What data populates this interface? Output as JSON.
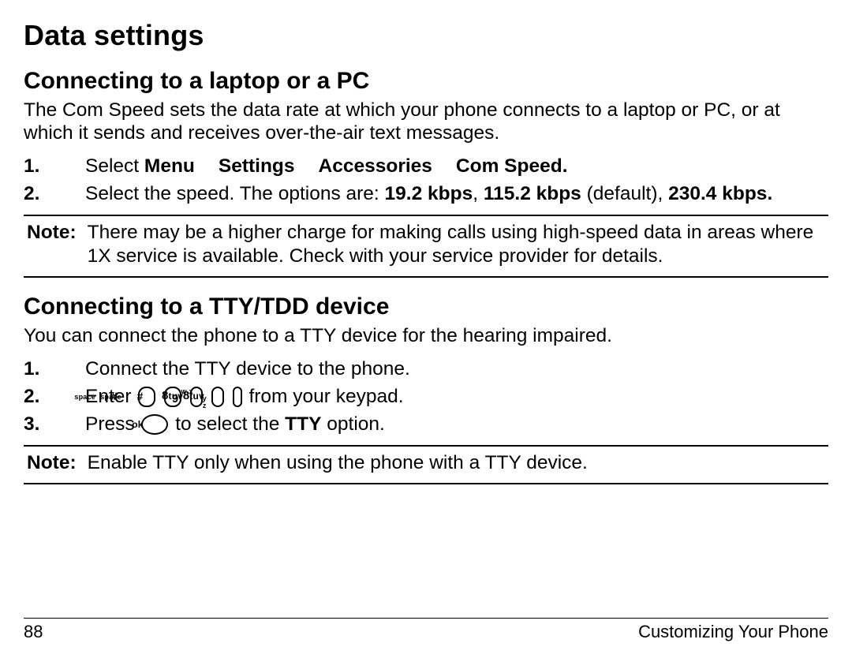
{
  "title": "Data settings",
  "section_pc": {
    "heading": "Connecting to a laptop or a PC",
    "intro": "The Com Speed sets the data rate at which your phone connects to a laptop or PC, or at which it sends and receives over-the-air text messages.",
    "step1_a": "Select ",
    "menu_path": {
      "a": "Menu",
      "b": "Settings",
      "c": "Accessories",
      "d": "Com Speed"
    },
    "step1_end": ".",
    "step2_a": "Select the speed. The options are: ",
    "opt1": "19.2 kbps",
    "sep": ", ",
    "opt2": "115.2 kbps",
    "default_suffix": " (default), ",
    "opt3": "230.4 kbps",
    "step2_end": ".",
    "note_label": "Note:",
    "note_text": "There may be a higher charge for making calls using high-speed data in areas where 1X service is available. Check with your service provider for details."
  },
  "section_tty": {
    "heading": "Connecting to a TTY/TDD device",
    "intro": "You can connect the phone to a TTY device for the hearing impaired.",
    "step1": "Connect the TTY device to the phone.",
    "step2_a": "Enter ",
    "step2_b": " from your keypad.",
    "step3_a": "Press ",
    "step3_b": " to select the ",
    "step3_tty": "TTY",
    "step3_c": " option.",
    "key_space": {
      "sp": "space",
      "hash": "#"
    },
    "key_8": {
      "d": "8",
      "letters": "tuv"
    },
    "key_9": {
      "wx_top": "w x",
      "wx_bot": "y z",
      "nine": "9"
    },
    "key_ok": "ok",
    "note_label": "Note:",
    "note_text": "Enable TTY only when using the phone with a TTY device."
  },
  "footer": {
    "page_num": "88",
    "section_name": "Customizing Your Phone"
  }
}
